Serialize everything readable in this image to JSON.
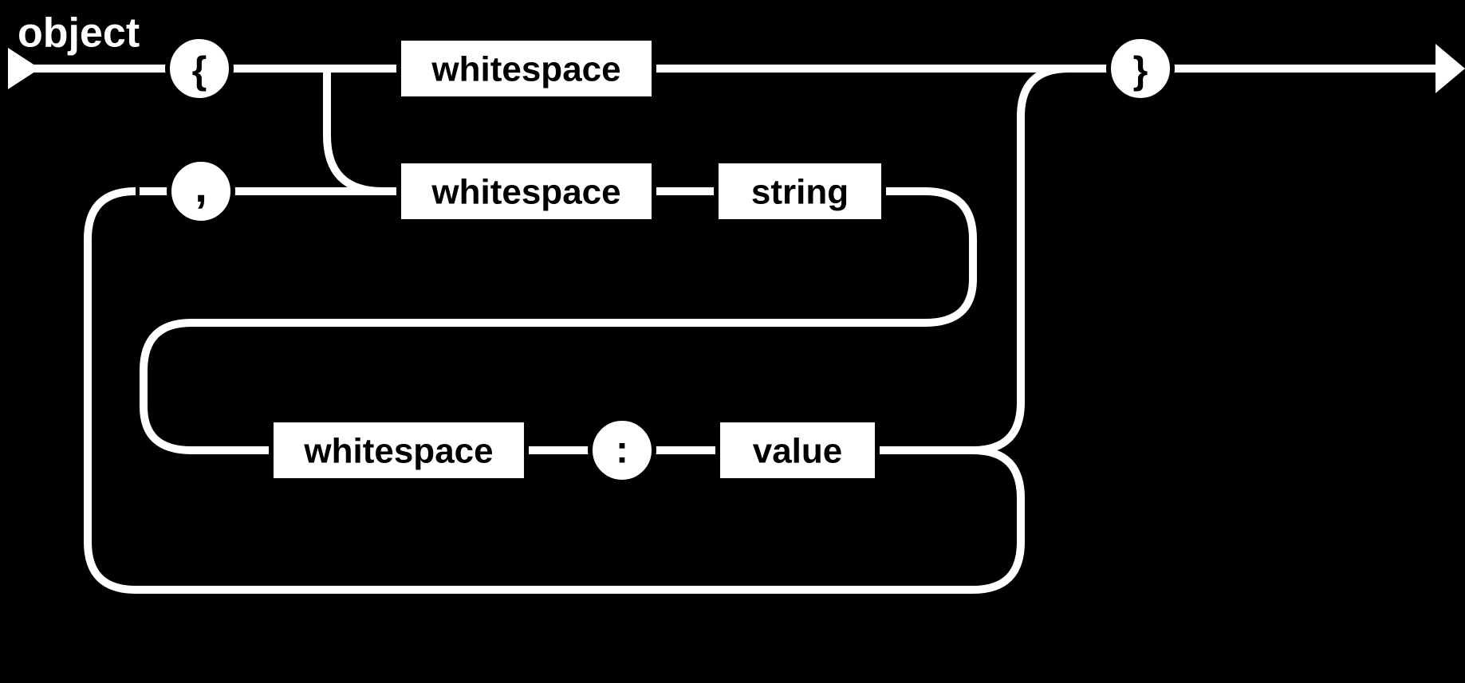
{
  "diagram": {
    "title": "object",
    "terminals": {
      "open_brace": "{",
      "close_brace": "}",
      "comma": ",",
      "colon": ":"
    },
    "nonterminals": {
      "ws1": "whitespace",
      "ws2": "whitespace",
      "ws3": "whitespace",
      "string": "string",
      "value": "value"
    }
  }
}
